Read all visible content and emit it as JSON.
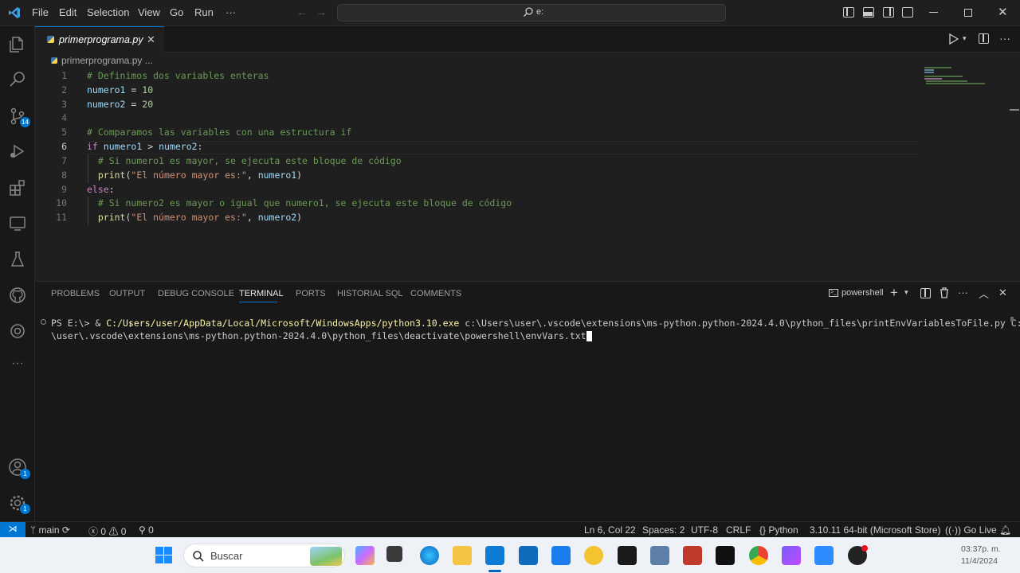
{
  "menu": [
    "File",
    "Edit",
    "Selection",
    "View",
    "Go",
    "Run",
    "···"
  ],
  "search": {
    "text": "e:"
  },
  "tab": {
    "label": "primerprograma.py",
    "close": "✕"
  },
  "breadcrumb": {
    "file": "primerprograma.py",
    "more": "..."
  },
  "badges": {
    "scm": "14",
    "accounts": "1",
    "settings": "1"
  },
  "editor": {
    "lines": [
      {
        "n": "1",
        "code": "# Definimos dos variables enteras"
      },
      {
        "n": "2",
        "code": "numero1 = 10"
      },
      {
        "n": "3",
        "code": "numero2 = 20"
      },
      {
        "n": "4",
        "code": ""
      },
      {
        "n": "5",
        "code": "# Comparamos las variables con una estructura if"
      },
      {
        "n": "6",
        "code": "if numero1 > numero2:"
      },
      {
        "n": "7",
        "code": "  # Si numero1 es mayor, se ejecuta este bloque de código"
      },
      {
        "n": "8",
        "code": "  print(\"El número mayor es:\", numero1)"
      },
      {
        "n": "9",
        "code": "else:"
      },
      {
        "n": "10",
        "code": "  # Si numero2 es mayor o igual que numero1, se ejecuta este bloque de código"
      },
      {
        "n": "11",
        "code": "  print(\"El número mayor es:\", numero2)"
      }
    ]
  },
  "panel": {
    "tabs": [
      "PROBLEMS",
      "OUTPUT",
      "DEBUG CONSOLE",
      "TERMINAL",
      "PORTS",
      "HISTORIAL SQL",
      "COMMENTS"
    ],
    "active": "TERMINAL",
    "shell": "powershell",
    "terminal_line1_prompt": "PS E:\\> & ",
    "terminal_line1_exe": "C:/Users/user/AppData/Local/Microsoft/WindowsApps/python3.10.exe",
    "terminal_line1_rest": " c:\\Users\\user\\.vscode\\extensions\\ms-python.python-2024.4.0\\python_files\\printEnvVariablesToFile.py C:\\Users",
    "terminal_line2": "\\user\\.vscode\\extensions\\ms-python.python-2024.4.0\\python_files\\deactivate\\powershell\\envVars.txt"
  },
  "status": {
    "branch": "main",
    "errors": "0",
    "warnings": "0",
    "ports": "0",
    "position": "Ln 6, Col 22",
    "spaces": "Spaces: 2",
    "encoding": "UTF-8",
    "eol": "CRLF",
    "language": "Python",
    "interpreter": "3.10.11 64-bit (Microsoft Store)",
    "golive": "Go Live"
  },
  "taskbar": {
    "search_placeholder": "Buscar",
    "time": "03:37p. m.",
    "date": "11/4/2024"
  }
}
